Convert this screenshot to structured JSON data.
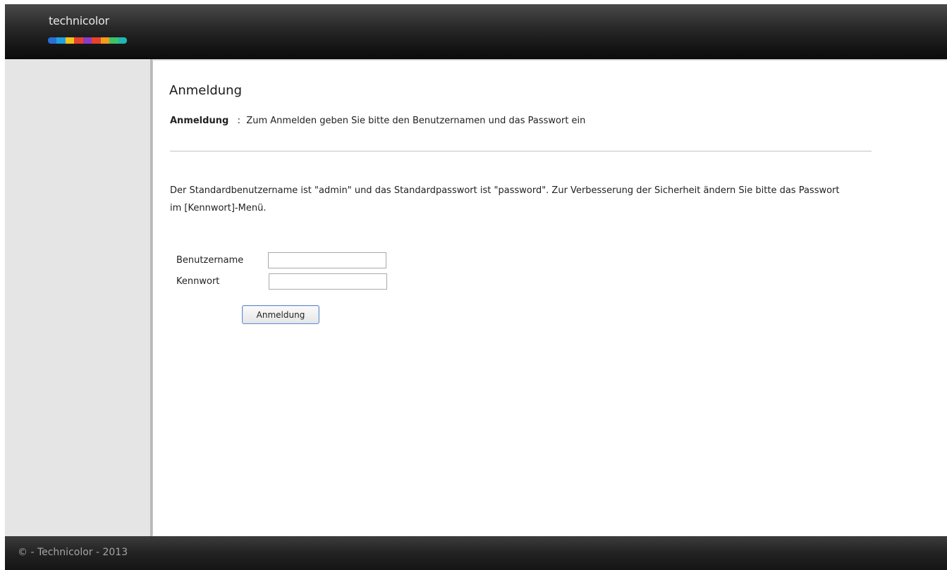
{
  "header": {
    "logo_text": "technicolor",
    "logo_colors": [
      "#2a6fd6",
      "#1fa0e0",
      "#f2c21a",
      "#e8422b",
      "#8a3cc6",
      "#e8422b",
      "#f59a1b",
      "#3cc46b",
      "#20b7b0"
    ]
  },
  "main": {
    "title": "Anmeldung",
    "subtitle_label": "Anmeldung",
    "subtitle_separator": ":",
    "subtitle_text": "Zum Anmelden geben Sie bitte den Benutzernamen und das Passwort ein",
    "info_text": "Der Standardbenutzername ist \"admin\" und das Standardpasswort ist \"password\". Zur Verbesserung der Sicherheit ändern Sie bitte das Passwort im [Kennwort]-Menü."
  },
  "form": {
    "username_label": "Benutzername",
    "username_value": "",
    "password_label": "Kennwort",
    "password_value": "",
    "submit_label": "Anmeldung"
  },
  "footer": {
    "copyright": "© - Technicolor - 2013"
  }
}
